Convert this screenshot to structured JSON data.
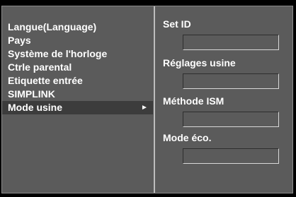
{
  "menu": {
    "items": [
      {
        "label": "Langue(Language)"
      },
      {
        "label": "Pays"
      },
      {
        "label": "Système de l'horloge"
      },
      {
        "label": "Ctrle parental"
      },
      {
        "label": "Etiquette entrée"
      },
      {
        "label": "SIMPLINK"
      },
      {
        "label": "Mode usine",
        "selected": true,
        "arrow": "►"
      }
    ]
  },
  "submenu": {
    "options": [
      {
        "label": "Set ID",
        "value": ""
      },
      {
        "label": "Réglages usine",
        "value": ""
      },
      {
        "label": "Méthode ISM",
        "value": ""
      },
      {
        "label": "Mode éco.",
        "value": ""
      }
    ]
  },
  "colors": {
    "panel_background": "#5b5b5b",
    "selected_row": "#3c3c3c",
    "text": "#ffffff",
    "divider": "#bdbdbd"
  }
}
